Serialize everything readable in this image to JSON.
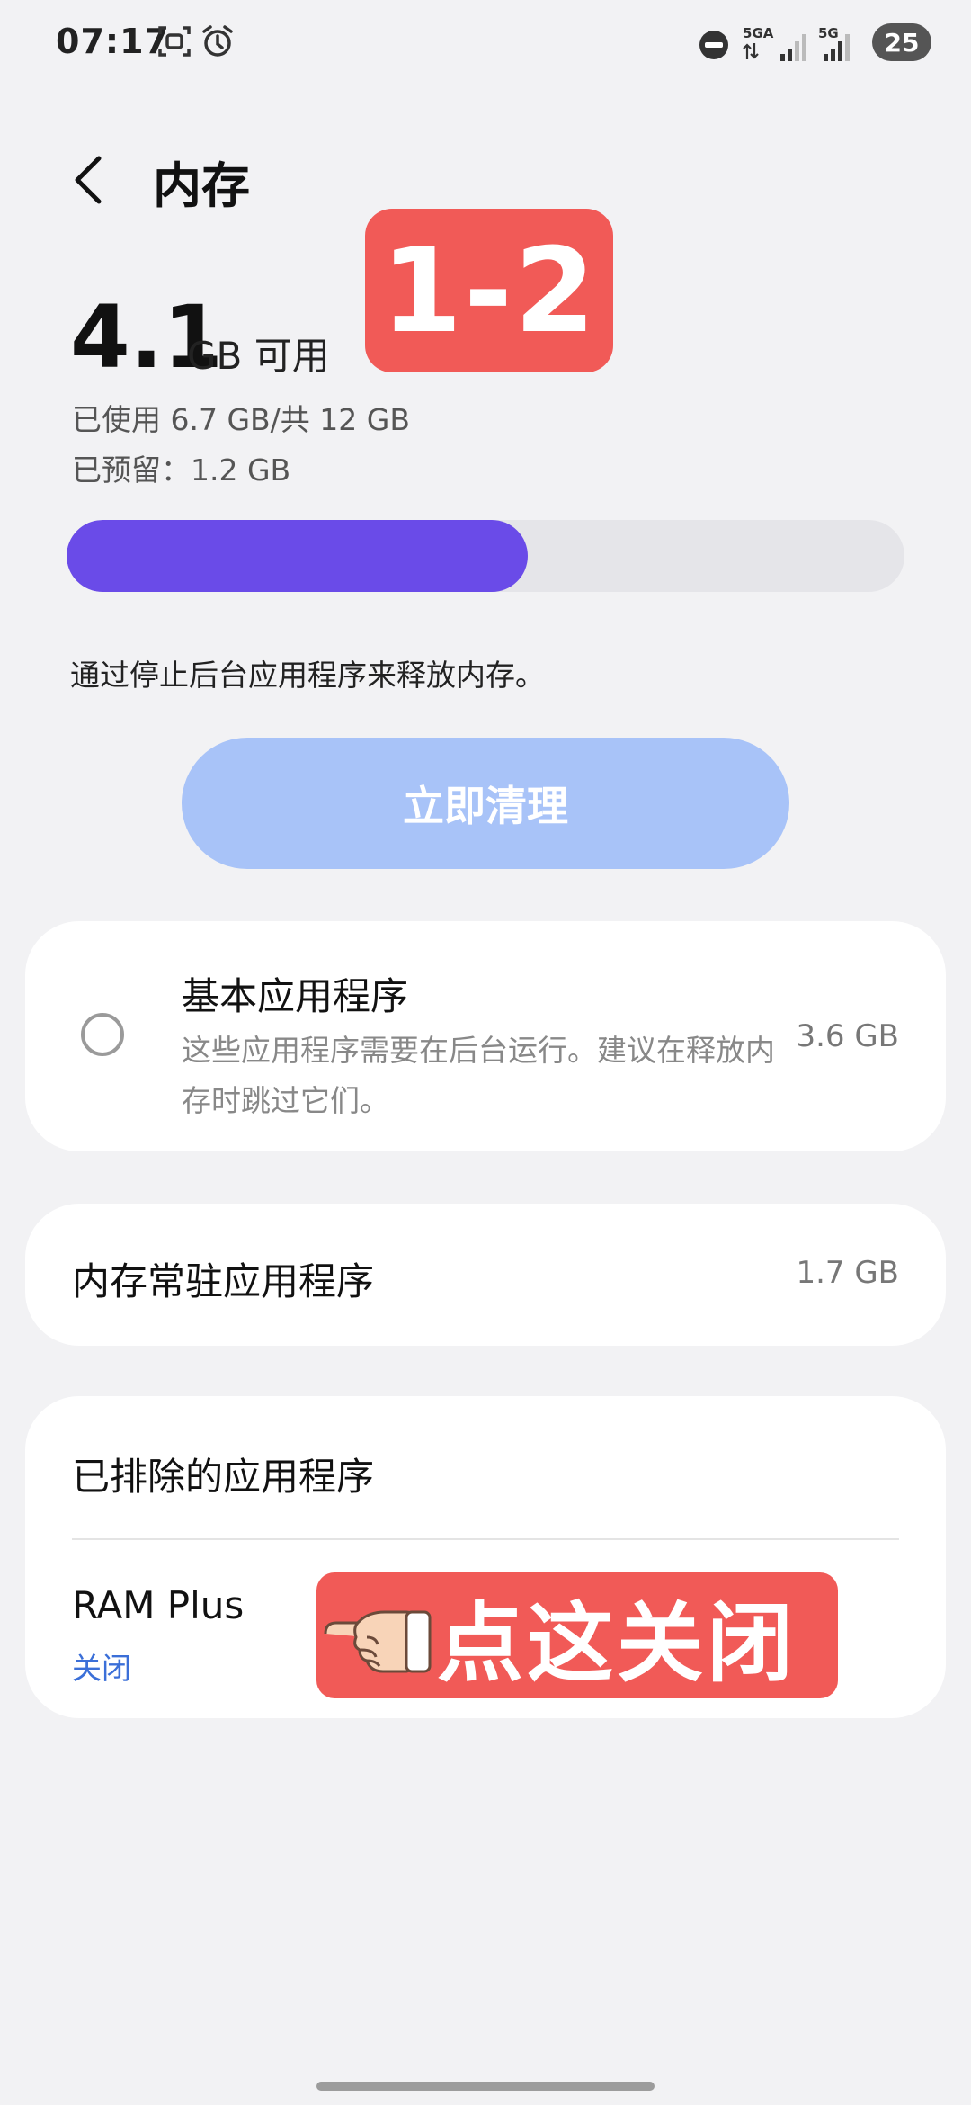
{
  "status_bar": {
    "time": "07:17",
    "left_icons": [
      "screenshot-icon",
      "alarm-icon"
    ],
    "right_icons": [
      "do-not-disturb-icon",
      "5ga-signal-icon",
      "5g-signal-icon"
    ],
    "network_label_1": "5GA",
    "network_label_2": "5G",
    "battery": "25"
  },
  "header": {
    "title": "内存",
    "back_icon": "back-chevron-icon"
  },
  "overlay": {
    "step_badge": "1-2",
    "tap_hint": "点这关闭",
    "tap_hint_icon": "pointing-hand-icon",
    "color": "#f15a57"
  },
  "memory": {
    "available_value": "4.1",
    "available_unit": "GB 可用",
    "used_text": "已使用 6.7 GB/共 12 GB",
    "reserved_text": "已预留：1.2 GB",
    "used_fraction": 0.55,
    "bar_color": "#6a4be8",
    "hint": "通过停止后台应用程序来释放内存。",
    "clean_button": "立即清理"
  },
  "essential_apps": {
    "title": "基本应用程序",
    "description": "这些应用程序需要在后台运行。建议在释放内存时跳过它们。",
    "size": "3.6 GB",
    "checked": false
  },
  "resident_apps": {
    "title": "内存常驻应用程序",
    "size": "1.7 GB"
  },
  "excluded_apps": {
    "title": "已排除的应用程序"
  },
  "ram_plus": {
    "title": "RAM Plus",
    "status": "关闭",
    "status_color": "#3b6fd8"
  }
}
